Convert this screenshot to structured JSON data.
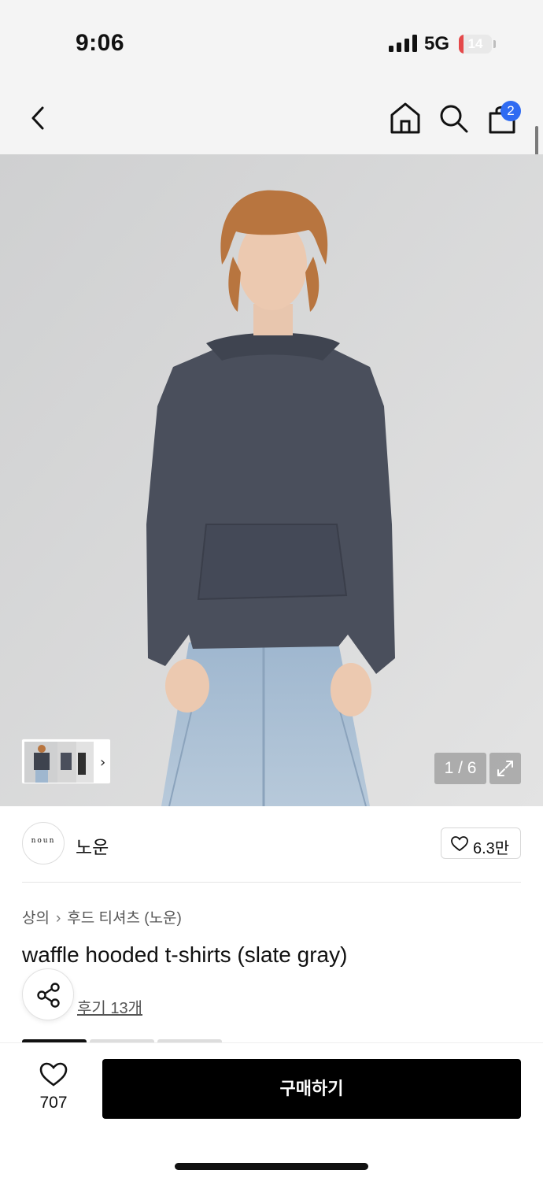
{
  "status_bar": {
    "time": "9:06",
    "network": "5G",
    "battery_level": "14",
    "battery_fraction": 0.14,
    "battery_color": "#e5494a"
  },
  "nav": {
    "back_icon": "chevron-left-icon",
    "home_icon": "home-icon",
    "search_icon": "search-icon",
    "bag_icon": "shopping-bag-icon",
    "cart_count": "2",
    "badge_color": "#2f6bf2"
  },
  "gallery": {
    "counter": "1 / 6",
    "expand_icon": "expand-icon",
    "thumb_arrow": "›"
  },
  "brand": {
    "logo_text": "noun",
    "name": "노운",
    "likes": "6.3만"
  },
  "product": {
    "breadcrumb": [
      "상의",
      "후드 티셔츠 (노운)"
    ],
    "breadcrumb_separator": "›",
    "title": "waffle hooded t-shirts (slate gray)",
    "share_icon": "share-icon",
    "reviews_link": "후기 13개"
  },
  "bottom_bar": {
    "wish_count": "707",
    "buy_label": "구매하기"
  }
}
